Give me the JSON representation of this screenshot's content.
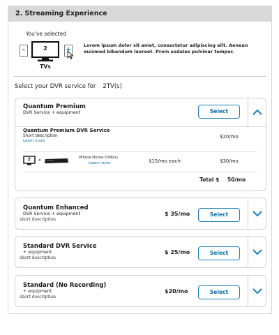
{
  "section": {
    "title": "2. Streaming Experience"
  },
  "tv_selector": {
    "selected_label": "You've selected",
    "minus": "-",
    "plus": "+",
    "count": "2",
    "unit_label": "TVs",
    "description": "Lorem ipsum dolor sit amet, consectetur adipiscing elit. Aenean euismod bibendum laoreet. Proin sodales pulvinar tempor."
  },
  "dvr_prompt": {
    "text": "Select your DVR service for",
    "tvs": "2TV(s)"
  },
  "cards": [
    {
      "title": "Quantum Premium",
      "subtitle": "DVR Service + equipment",
      "button": "Select",
      "expanded": true,
      "detail": {
        "name": "Quantum Premium DVR Service",
        "short_desc": "Short description",
        "learn_more": "Learn more",
        "price": "$20/mo",
        "equip_count": "2",
        "equip_x": "x",
        "equip_name": "Whole-Home DVR(s)",
        "equip_learn_more": "Learn more",
        "equip_each": "$15/mo each",
        "equip_price": "$30/mo",
        "total_label": "Total $",
        "total_value": "50/mo"
      }
    },
    {
      "title": "Quantum Enhanced",
      "subtitle": "DVR Service + equipment",
      "desc": "short description",
      "price": "$ 35/mo",
      "button": "Select"
    },
    {
      "title": "Standard DVR Service",
      "subtitle": "+ equipment",
      "desc": "short description",
      "price": "$ 25/mo",
      "button": "Select"
    },
    {
      "title": "Standard (No Recording)",
      "subtitle": "+ equipment",
      "desc": "short description",
      "price": "$20/mo",
      "button": "Select"
    }
  ],
  "colors": {
    "accent": "#0a6ea6",
    "header_bg": "#d9d9d9",
    "border": "#cfcfcf"
  },
  "icons": [
    "tv-icon",
    "cursor-icon",
    "chevron-up-icon",
    "chevron-down-icon",
    "dvr-box-icon"
  ]
}
